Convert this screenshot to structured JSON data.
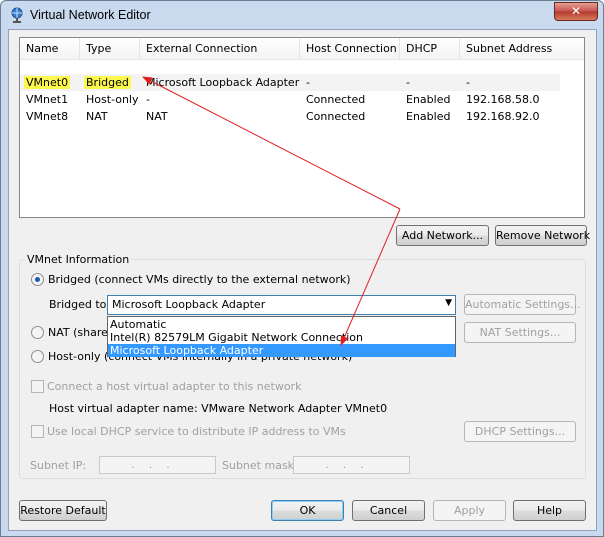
{
  "window": {
    "title": "Virtual Network Editor",
    "close_glyph": "✕"
  },
  "list": {
    "columns": [
      "Name",
      "Type",
      "External Connection",
      "Host Connection",
      "DHCP",
      "Subnet Address"
    ],
    "rows": [
      {
        "name": "VMnet0",
        "type": "Bridged",
        "external": "Microsoft Loopback Adapter",
        "host": "-",
        "dhcp": "-",
        "subnet": "-"
      },
      {
        "name": "VMnet1",
        "type": "Host-only",
        "external": "-",
        "host": "Connected",
        "dhcp": "Enabled",
        "subnet": "192.168.58.0"
      },
      {
        "name": "VMnet8",
        "type": "NAT",
        "external": "NAT",
        "host": "Connected",
        "dhcp": "Enabled",
        "subnet": "192.168.92.0"
      }
    ]
  },
  "buttons": {
    "add_network": "Add Network...",
    "remove_network": "Remove Network",
    "automatic_settings": "Automatic Settings...",
    "nat_settings": "NAT Settings...",
    "dhcp_settings": "DHCP Settings...",
    "restore_default": "Restore Default",
    "ok": "OK",
    "cancel": "Cancel",
    "apply": "Apply",
    "help": "Help"
  },
  "vmnet_info": {
    "group_label": "VMnet Information",
    "bridged_label": "Bridged (connect VMs directly to the external network)",
    "bridged_to_label": "Bridged to:",
    "bridged_to_value": "Microsoft Loopback Adapter",
    "dropdown_options": [
      "Automatic",
      "Intel(R) 82579LM Gigabit Network Connection",
      "Microsoft Loopback Adapter"
    ],
    "nat_label_partial": "NAT (shared",
    "hostonly_label": "Host-only (connect VMs internally in a private network)",
    "connect_adapter_label": "Connect a host virtual adapter to this network",
    "adapter_name_label": "Host virtual adapter name: VMware Network Adapter VMnet0",
    "dhcp_label": "Use local DHCP service to distribute IP address to VMs",
    "subnet_ip_label": "Subnet IP:",
    "subnet_mask_label": "Subnet mask:",
    "ip_placeholder": "...",
    "mask_placeholder": "..."
  },
  "colors": {
    "highlight": "#fdf84e",
    "annotation_arrow": "#e02020",
    "dropdown_selection": "#3399ff"
  }
}
